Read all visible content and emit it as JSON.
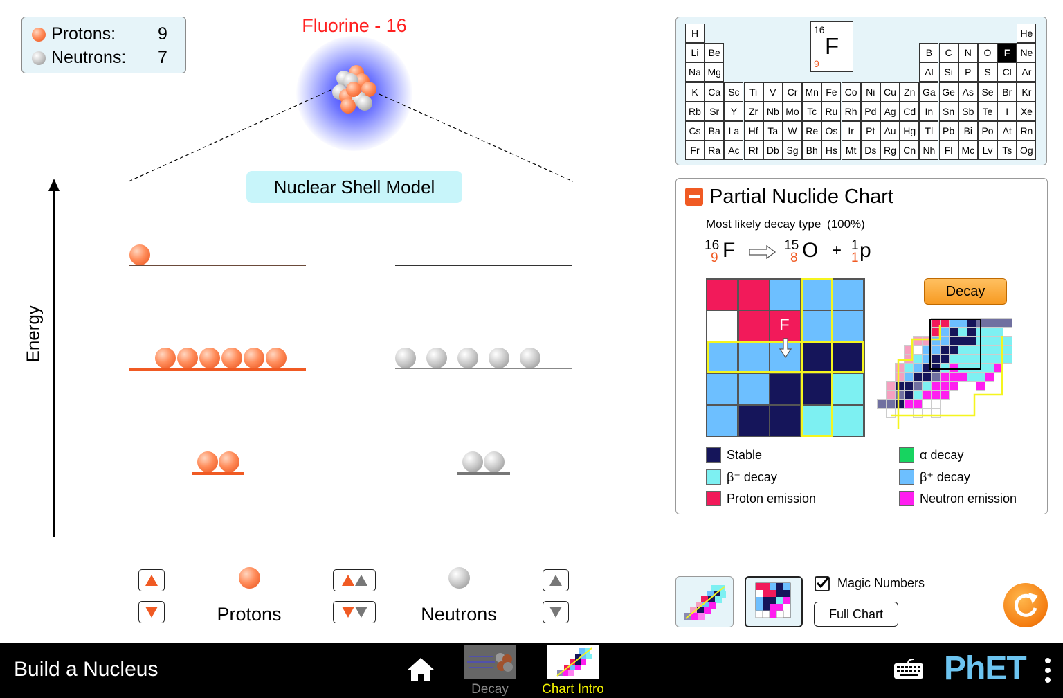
{
  "counts": {
    "protons_label": "Protons:",
    "protons_value": "9",
    "neutrons_label": "Neutrons:",
    "neutrons_value": "7"
  },
  "isotope_title": "Fluorine - 16",
  "shell_model_label": "Nuclear Shell Model",
  "energy_label": "Energy",
  "protons_label": "Protons",
  "neutrons_label": "Neutrons",
  "periodic_table": {
    "rows": [
      [
        "H",
        "",
        "",
        "",
        "",
        "",
        "",
        "",
        "",
        "",
        "",
        "",
        "",
        "",
        "",
        "",
        "",
        "He"
      ],
      [
        "Li",
        "Be",
        "",
        "",
        "",
        "",
        "",
        "",
        "",
        "",
        "",
        "",
        "B",
        "C",
        "N",
        "O",
        "F",
        "Ne"
      ],
      [
        "Na",
        "Mg",
        "",
        "",
        "",
        "",
        "",
        "",
        "",
        "",
        "",
        "",
        "Al",
        "Si",
        "P",
        "S",
        "Cl",
        "Ar"
      ],
      [
        "K",
        "Ca",
        "Sc",
        "Ti",
        "V",
        "Cr",
        "Mn",
        "Fe",
        "Co",
        "Ni",
        "Cu",
        "Zn",
        "Ga",
        "Ge",
        "As",
        "Se",
        "Br",
        "Kr"
      ],
      [
        "Rb",
        "Sr",
        "Y",
        "Zr",
        "Nb",
        "Mo",
        "Tc",
        "Ru",
        "Rh",
        "Pd",
        "Ag",
        "Cd",
        "In",
        "Sn",
        "Sb",
        "Te",
        "I",
        "Xe"
      ],
      [
        "Cs",
        "Ba",
        "La",
        "Hf",
        "Ta",
        "W",
        "Re",
        "Os",
        "Ir",
        "Pt",
        "Au",
        "Hg",
        "Tl",
        "Pb",
        "Bi",
        "Po",
        "At",
        "Rn"
      ],
      [
        "Fr",
        "Ra",
        "Ac",
        "Rf",
        "Db",
        "Sg",
        "Bh",
        "Hs",
        "Mt",
        "Ds",
        "Rg",
        "Cn",
        "Nh",
        "Fl",
        "Mc",
        "Lv",
        "Ts",
        "Og"
      ]
    ],
    "selected": "F",
    "big_cell": {
      "mass": "16",
      "symbol": "F",
      "atomic": "9"
    }
  },
  "nuclide_panel": {
    "title": "Partial Nuclide Chart",
    "decay_type_label": "Most likely decay type",
    "decay_percent": "(100%)",
    "equation": {
      "parent_mass": "16",
      "parent_z": "9",
      "parent_symbol": "F",
      "d1_mass": "15",
      "d1_z": "8",
      "d1_symbol": "O",
      "plus": "+",
      "d2_mass": "1",
      "d2_z": "1",
      "d2_symbol": "p"
    },
    "grid_marker": "F",
    "decay_button": "Decay",
    "colors": {
      "stable": "#15155a",
      "beta_minus": "#7df0f2",
      "proton": "#f21a5a",
      "alpha": "#17d460",
      "beta_plus": "#6dbfff",
      "neutron": "#ff1ef0",
      "magic": "#f5f51e"
    },
    "legend": [
      {
        "label": "Stable",
        "color": "#15155a"
      },
      {
        "label": "α decay",
        "color": "#17d460"
      },
      {
        "label": "β⁻ decay",
        "color": "#7df0f2"
      },
      {
        "label": "β⁺ decay",
        "color": "#6dbfff"
      },
      {
        "label": "Proton emission",
        "color": "#f21a5a"
      },
      {
        "label": "Neutron emission",
        "color": "#ff1ef0"
      }
    ]
  },
  "controls": {
    "magic_numbers_label": "Magic Numbers",
    "magic_numbers_checked": true,
    "full_chart_button": "Full Chart"
  },
  "navbar": {
    "app_title": "Build a Nucleus",
    "screens": [
      "Decay",
      "Chart Intro"
    ],
    "active_screen": "Chart Intro",
    "brand": "PhET"
  }
}
